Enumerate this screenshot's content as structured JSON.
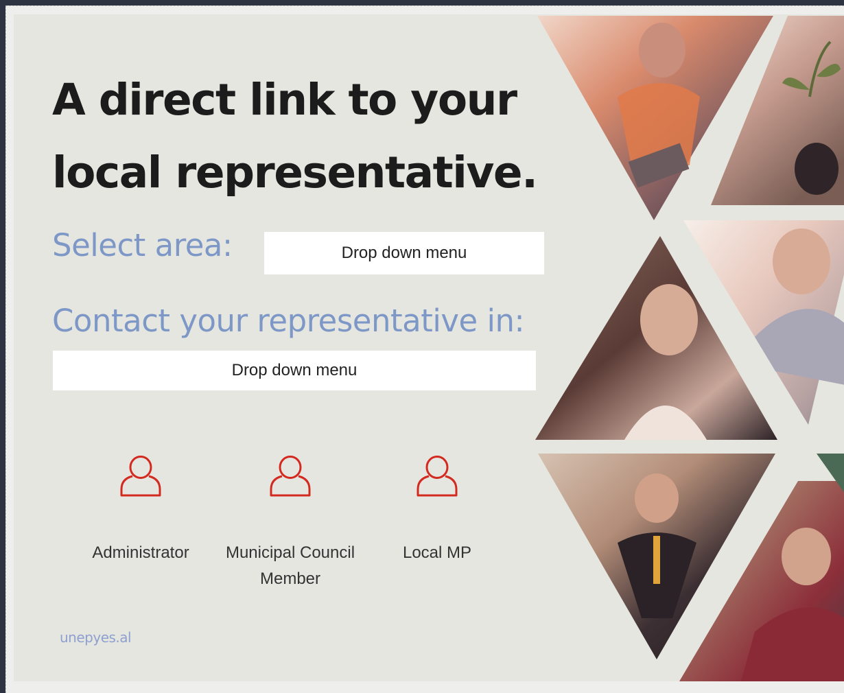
{
  "headline": "A direct link to your local representative.",
  "select_area": {
    "label": "Select area:",
    "dropdown_text": "Drop down menu"
  },
  "contact": {
    "label": "Contact your representative in:",
    "dropdown_text": "Drop down menu"
  },
  "representatives": [
    {
      "label": "Administrator",
      "icon": "person-icon"
    },
    {
      "label": "Municipal Council Member",
      "icon": "person-icon"
    },
    {
      "label": "Local MP",
      "icon": "person-icon"
    }
  ],
  "footer": {
    "link_text": "unepyes.al"
  },
  "colors": {
    "background": "#e6e6e1",
    "headline": "#1c1c1c",
    "label_blue": "#7d97c6",
    "icon_red": "#d32a20",
    "link_blue": "#8ea0cf"
  },
  "photo_collage": [
    {
      "subject": "worker in orange vest"
    },
    {
      "subject": "hand holding a seedling"
    },
    {
      "subject": "smiling girl"
    },
    {
      "subject": "smiling boy"
    },
    {
      "subject": "man in suit"
    },
    {
      "subject": "excited boy"
    }
  ]
}
